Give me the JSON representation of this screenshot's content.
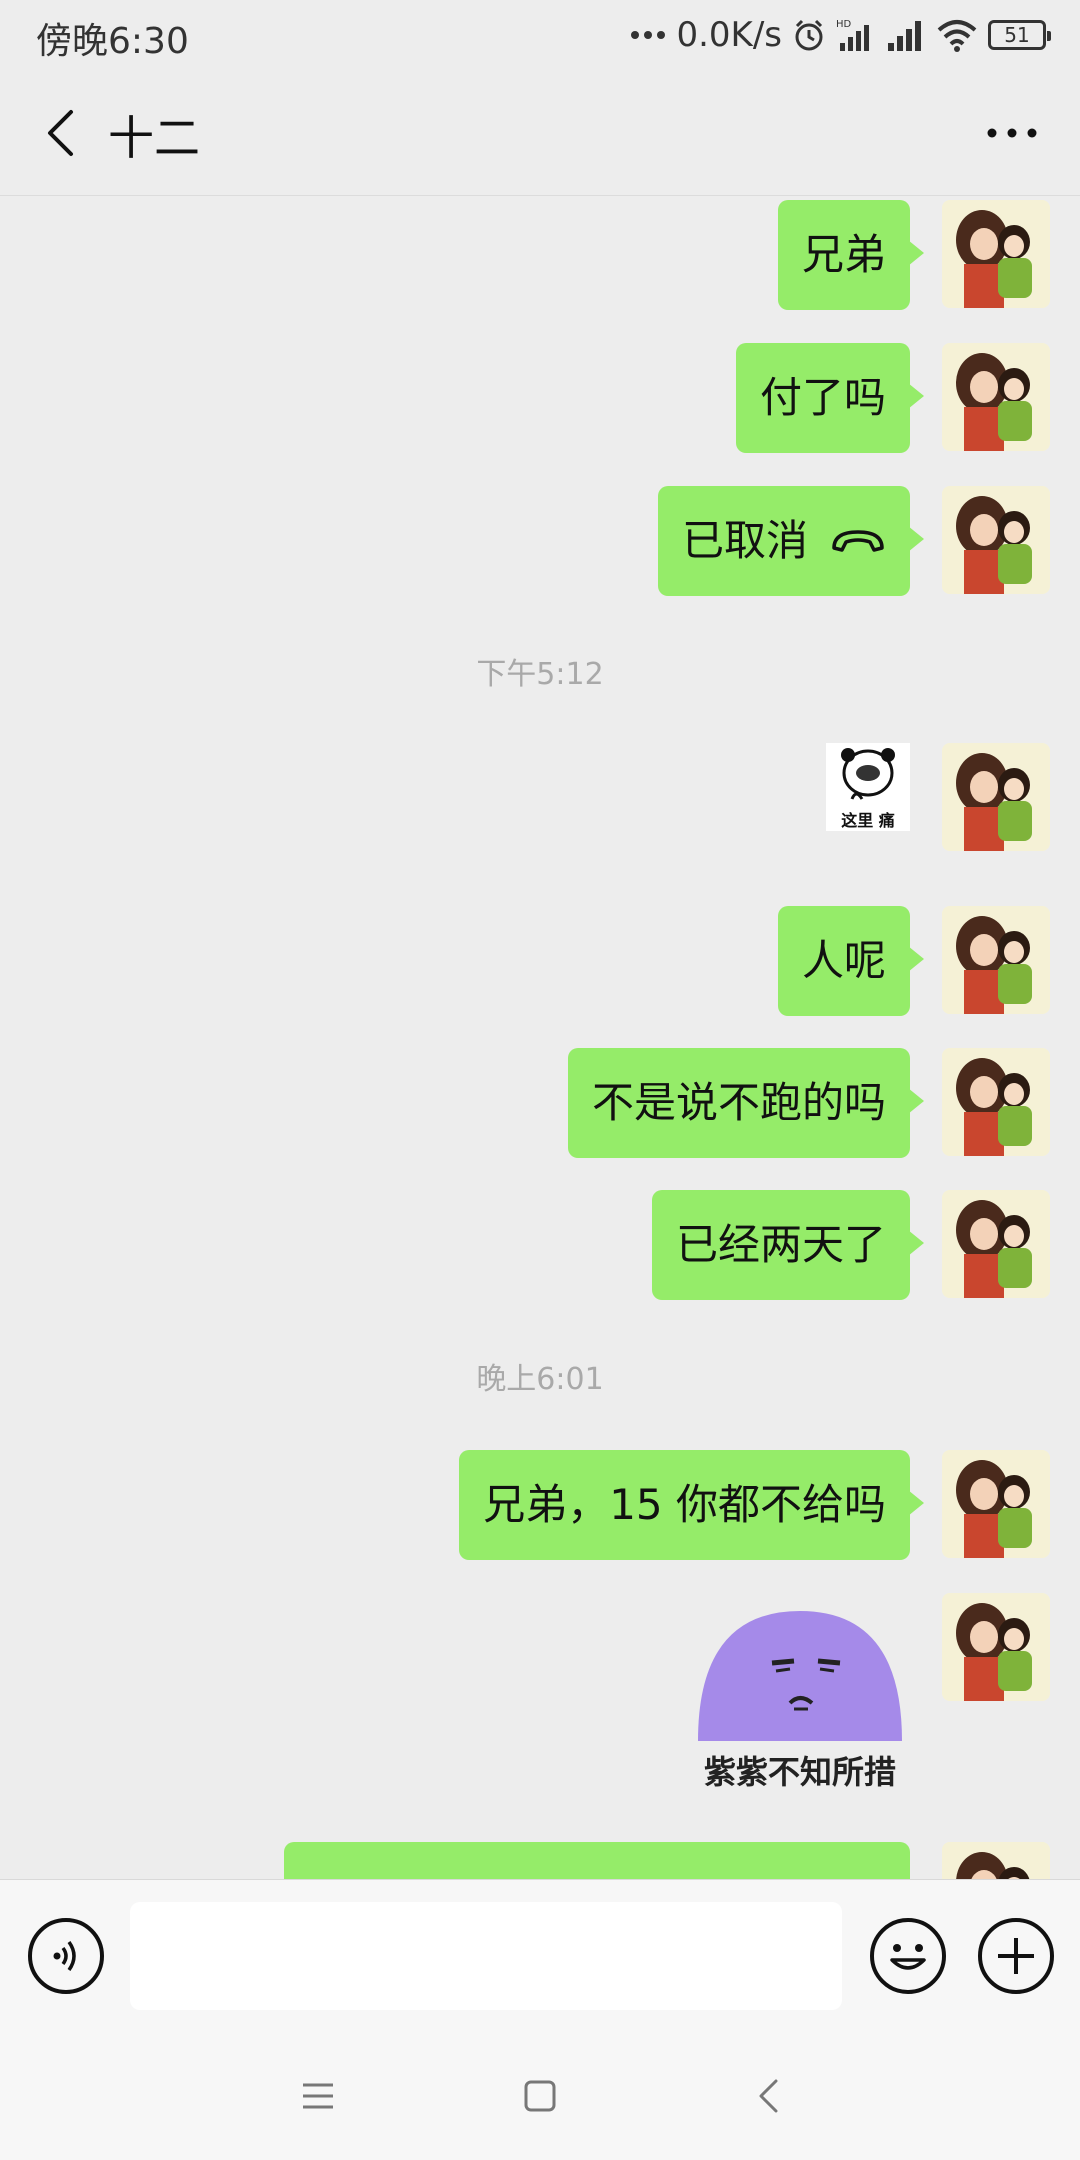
{
  "status_bar": {
    "time": "傍晚6:30",
    "net_speed": "0.0K/s",
    "battery": "51",
    "icons": [
      "dots-icon",
      "alarm-icon",
      "hd-signal-icon",
      "signal-icon",
      "wifi-icon",
      "battery-icon"
    ]
  },
  "nav": {
    "title": "十二",
    "back_icon": "chevron-left-icon",
    "more_icon": "more-dots-icon"
  },
  "messages": [
    {
      "type": "text",
      "text": "兄弟"
    },
    {
      "type": "text",
      "text": "付了吗"
    },
    {
      "type": "call",
      "text": "已取消",
      "icon": "phone-hangup-icon"
    },
    {
      "type": "timestamp",
      "text": "下午5:12"
    },
    {
      "type": "sticker",
      "caption": "这里 痛"
    },
    {
      "type": "text",
      "text": "人呢"
    },
    {
      "type": "text",
      "text": "不是说不跑的吗"
    },
    {
      "type": "text",
      "text": "已经两天了"
    },
    {
      "type": "timestamp",
      "text": "晚上6:01"
    },
    {
      "type": "text",
      "text": "兄弟，15 你都不给吗"
    },
    {
      "type": "sticker",
      "caption": "紫紫不知所措"
    }
  ],
  "input_bar": {
    "voice_icon": "voice-icon",
    "input_value": "",
    "emoji_icon": "emoji-icon",
    "plus_icon": "plus-icon"
  },
  "system_nav": {
    "icons": [
      "menu-icon",
      "home-icon",
      "back-icon"
    ]
  },
  "colors": {
    "bubble": "#95ec69",
    "background": "#ededed",
    "timestamp": "#a9a9a9"
  }
}
